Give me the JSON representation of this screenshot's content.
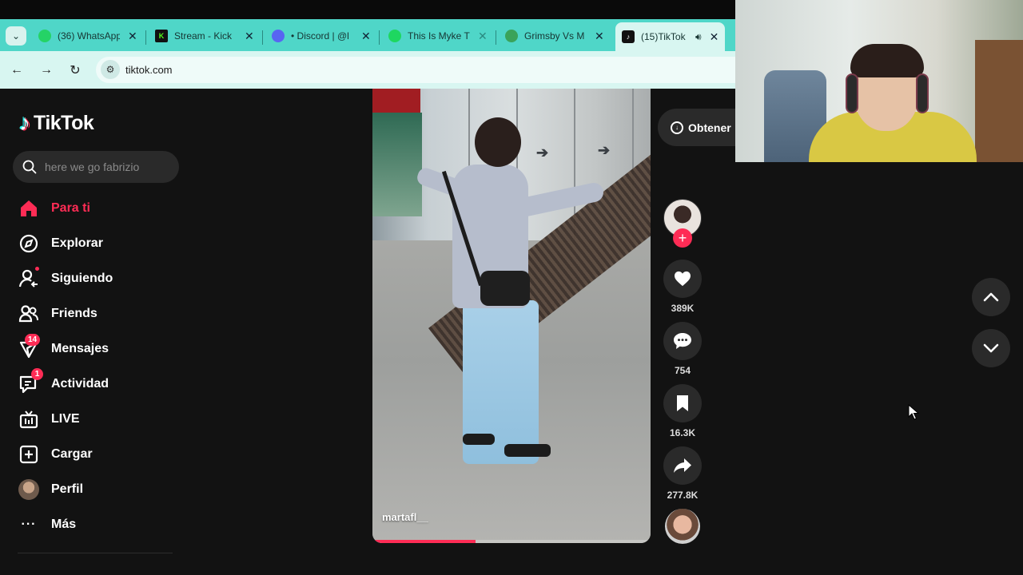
{
  "browser": {
    "tabs": [
      {
        "title": "(36) WhatsApp",
        "favicon_color": "#25d366",
        "favicon_text": "36"
      },
      {
        "title": "Stream - Kick",
        "favicon_color": "#111111",
        "favicon_text": "K"
      },
      {
        "title": "• Discord | @l",
        "favicon_color": "#5865f2",
        "favicon_text": ""
      },
      {
        "title": "This Is Myke T",
        "favicon_color": "#1ed760",
        "favicon_text": ""
      },
      {
        "title": "Grimsby Vs M",
        "favicon_color": "#3aa35a",
        "favicon_text": ""
      },
      {
        "title": "(15)TikTok",
        "favicon_color": "#111111",
        "favicon_text": "♪"
      }
    ],
    "url": "tiktok.com"
  },
  "tiktok": {
    "logo_text": "TikTok",
    "search_placeholder": "here we go fabrizio",
    "nav": [
      {
        "label": "Para ti",
        "icon": "home-icon",
        "active": true
      },
      {
        "label": "Explorar",
        "icon": "compass-icon"
      },
      {
        "label": "Siguiendo",
        "icon": "following-icon"
      },
      {
        "label": "Friends",
        "icon": "friends-icon"
      },
      {
        "label": "Mensajes",
        "icon": "messages-icon",
        "badge": "14"
      },
      {
        "label": "Actividad",
        "icon": "activity-icon",
        "badge": "1"
      },
      {
        "label": "LIVE",
        "icon": "live-icon"
      },
      {
        "label": "Cargar",
        "icon": "upload-icon"
      },
      {
        "label": "Perfil",
        "icon": "profile-icon"
      },
      {
        "label": "Más",
        "icon": "more-icon"
      }
    ],
    "get_app_label": "Obtener",
    "video": {
      "author": "martafl__",
      "progress": 0.37
    },
    "actions": {
      "likes": "389K",
      "comments": "754",
      "saves": "16.3K",
      "shares": "277.8K"
    }
  },
  "colors": {
    "accent": "#fe2c55",
    "tab_strip": "#4fd6c8",
    "background": "#121212"
  }
}
